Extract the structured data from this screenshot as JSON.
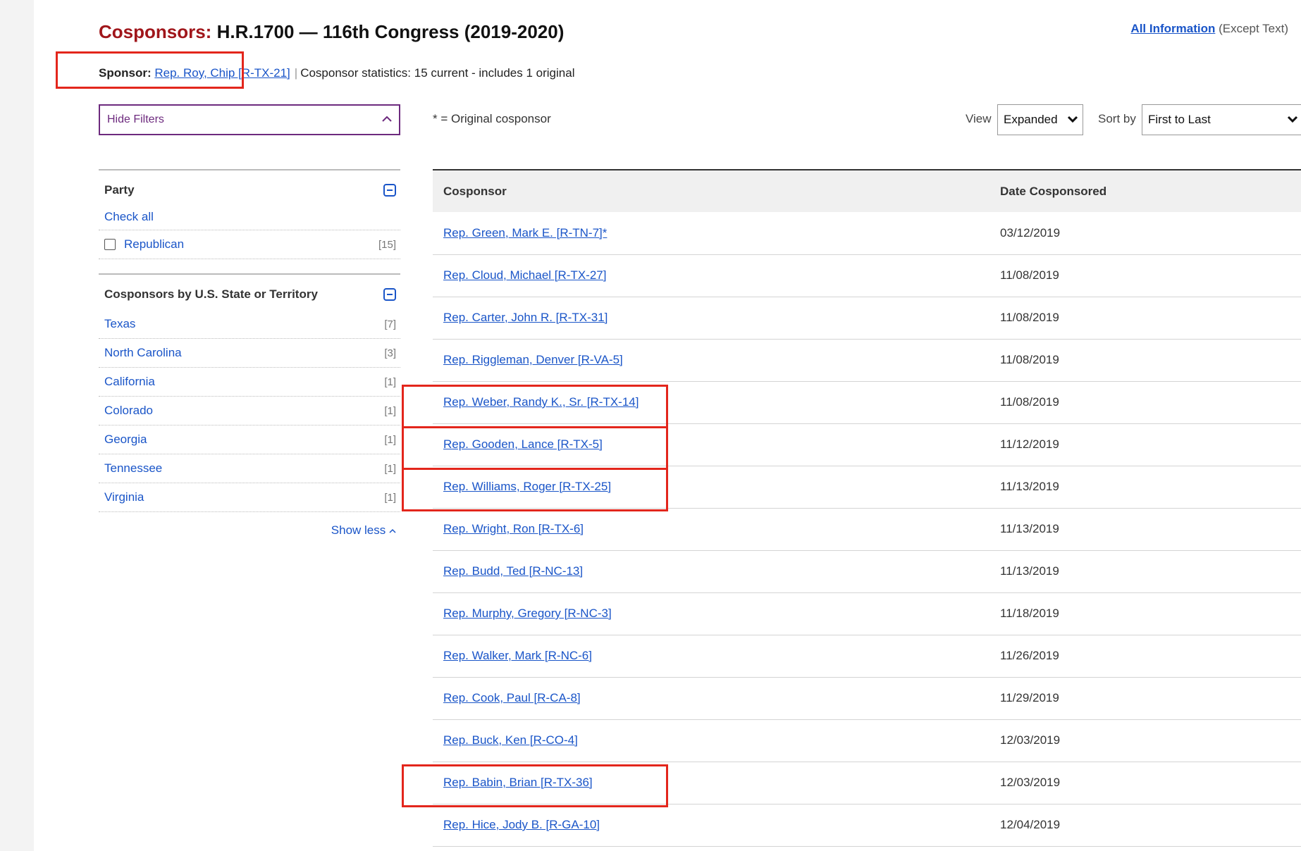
{
  "header": {
    "title_prefix": "Cosponsors:",
    "title_rest": " H.R.1700 — 116th Congress (2019-2020)",
    "all_info_link": "All Information",
    "all_info_note": " (Except Text)"
  },
  "sponsor": {
    "label": "Sponsor:",
    "name": "Rep. Roy, Chip [R-TX-21]",
    "separator": "|",
    "stats": "Cosponsor statistics: 15 current - includes 1 original"
  },
  "filters": {
    "hide_label": "Hide Filters",
    "party": {
      "title": "Party",
      "check_all": "Check all",
      "items": [
        {
          "name": "Republican",
          "count": "[15]"
        }
      ]
    },
    "state": {
      "title": "Cosponsors by U.S. State or Territory",
      "items": [
        {
          "name": "Texas",
          "count": "[7]"
        },
        {
          "name": "North Carolina",
          "count": "[3]"
        },
        {
          "name": "California",
          "count": "[1]"
        },
        {
          "name": "Colorado",
          "count": "[1]"
        },
        {
          "name": "Georgia",
          "count": "[1]"
        },
        {
          "name": "Tennessee",
          "count": "[1]"
        },
        {
          "name": "Virginia",
          "count": "[1]"
        }
      ],
      "show_less": "Show less"
    }
  },
  "toolbar": {
    "legend": "* = Original cosponsor",
    "view_label": "View",
    "view_value": "Expanded",
    "sort_label": "Sort by",
    "sort_value": "First to Last"
  },
  "table": {
    "headers": [
      "Cosponsor",
      "Date Cosponsored"
    ],
    "rows": [
      {
        "name": "Rep. Green, Mark E. [R-TN-7]*",
        "date": "03/12/2019"
      },
      {
        "name": "Rep. Cloud, Michael [R-TX-27]",
        "date": "11/08/2019"
      },
      {
        "name": "Rep. Carter, John R. [R-TX-31]",
        "date": "11/08/2019"
      },
      {
        "name": "Rep. Riggleman, Denver [R-VA-5]",
        "date": "11/08/2019"
      },
      {
        "name": "Rep. Weber, Randy K., Sr. [R-TX-14]",
        "date": "11/08/2019"
      },
      {
        "name": "Rep. Gooden, Lance [R-TX-5]",
        "date": "11/12/2019"
      },
      {
        "name": "Rep. Williams, Roger [R-TX-25]",
        "date": "11/13/2019"
      },
      {
        "name": "Rep. Wright, Ron [R-TX-6]",
        "date": "11/13/2019"
      },
      {
        "name": "Rep. Budd, Ted [R-NC-13]",
        "date": "11/13/2019"
      },
      {
        "name": "Rep. Murphy, Gregory [R-NC-3]",
        "date": "11/18/2019"
      },
      {
        "name": "Rep. Walker, Mark [R-NC-6]",
        "date": "11/26/2019"
      },
      {
        "name": "Rep. Cook, Paul [R-CA-8]",
        "date": "11/29/2019"
      },
      {
        "name": "Rep. Buck, Ken [R-CO-4]",
        "date": "12/03/2019"
      },
      {
        "name": "Rep. Babin, Brian [R-TX-36]",
        "date": "12/03/2019"
      },
      {
        "name": "Rep. Hice, Jody B. [R-GA-10]",
        "date": "12/04/2019"
      }
    ]
  },
  "colors": {
    "title_accent": "#a0161b",
    "link": "#1a55c8",
    "highlight": "#e3261c",
    "filter_border": "#6d2a7e"
  }
}
